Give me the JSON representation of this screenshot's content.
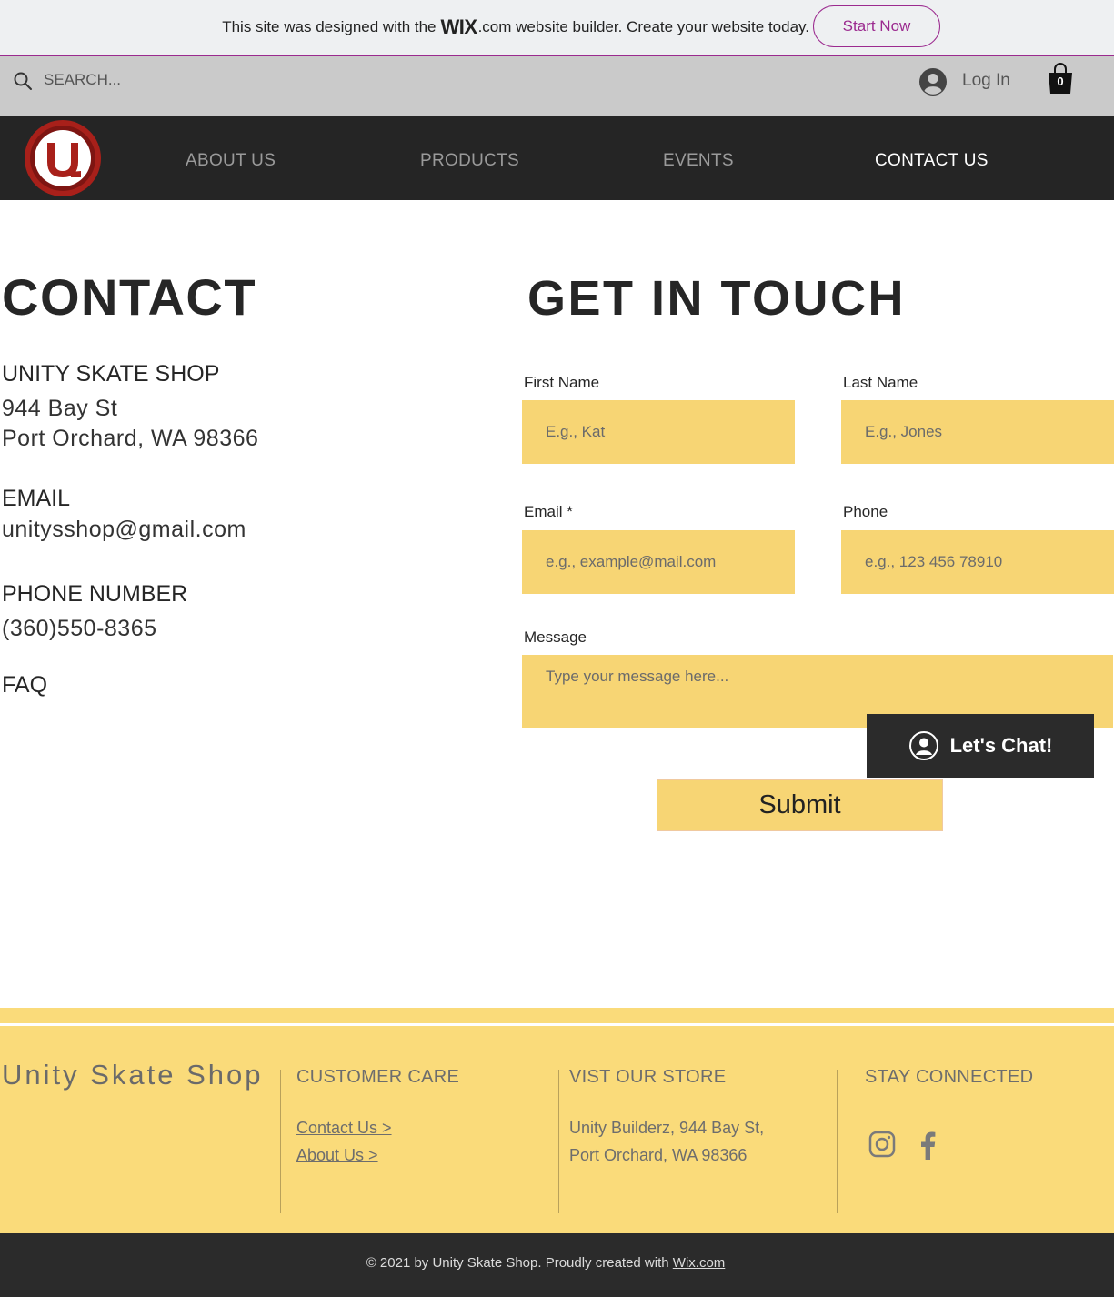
{
  "wix_banner": {
    "text_before": "This site was designed with the",
    "logo_text": "WIX",
    "text_after": ".com website builder. Create your website today.",
    "button": "Start Now"
  },
  "header": {
    "search_placeholder": "SEARCH...",
    "login_label": "Log In",
    "cart_count": "0"
  },
  "nav": {
    "logo_letter": "u",
    "items": [
      "ABOUT US",
      "PRODUCTS",
      "EVENTS",
      "CONTACT US"
    ],
    "active": "CONTACT US"
  },
  "contact": {
    "heading": "CONTACT",
    "shop_name": "UNITY SKATE SHOP",
    "address_line1": "944 Bay St",
    "address_line2": "Port Orchard, WA 98366",
    "email_label": "EMAIL",
    "email": "unitysshop@gmail.com",
    "phone_label": "PHONE NUMBER",
    "phone": "(360)550-8365",
    "faq": "FAQ"
  },
  "form": {
    "heading": "GET IN TOUCH",
    "first_name_label": "First Name",
    "first_name_placeholder": "E.g., Kat",
    "last_name_label": "Last Name",
    "last_name_placeholder": "E.g., Jones",
    "email_label": "Email *",
    "email_placeholder": "e.g., example@mail.com",
    "phone_label": "Phone",
    "phone_placeholder": "e.g., 123 456 78910",
    "message_label": "Message",
    "message_placeholder": "Type your message here...",
    "submit": "Submit"
  },
  "chat": {
    "label": "Let's Chat!"
  },
  "footer": {
    "brand": "Unity Skate Shop",
    "customer_care_title": "CUSTOMER CARE",
    "links": [
      "Contact Us >",
      "About Us >"
    ],
    "store_title": "VIST OUR STORE",
    "store_line1": "Unity Builderz, 944 Bay St,",
    "store_line2": "Port Orchard, WA 98366",
    "connected_title": "STAY CONNECTED",
    "copyright_text": "© 2021 by Unity Skate Shop. Proudly created with ",
    "copyright_link": "Wix.com"
  },
  "colors": {
    "accent_purple": "#9b2a8f",
    "form_yellow": "#f7d574",
    "footer_yellow": "#fadb7a",
    "nav_dark": "#252525"
  },
  "icons": [
    "search-icon",
    "avatar-icon",
    "cart-icon",
    "chat-avatar-icon",
    "instagram-icon",
    "facebook-icon"
  ]
}
